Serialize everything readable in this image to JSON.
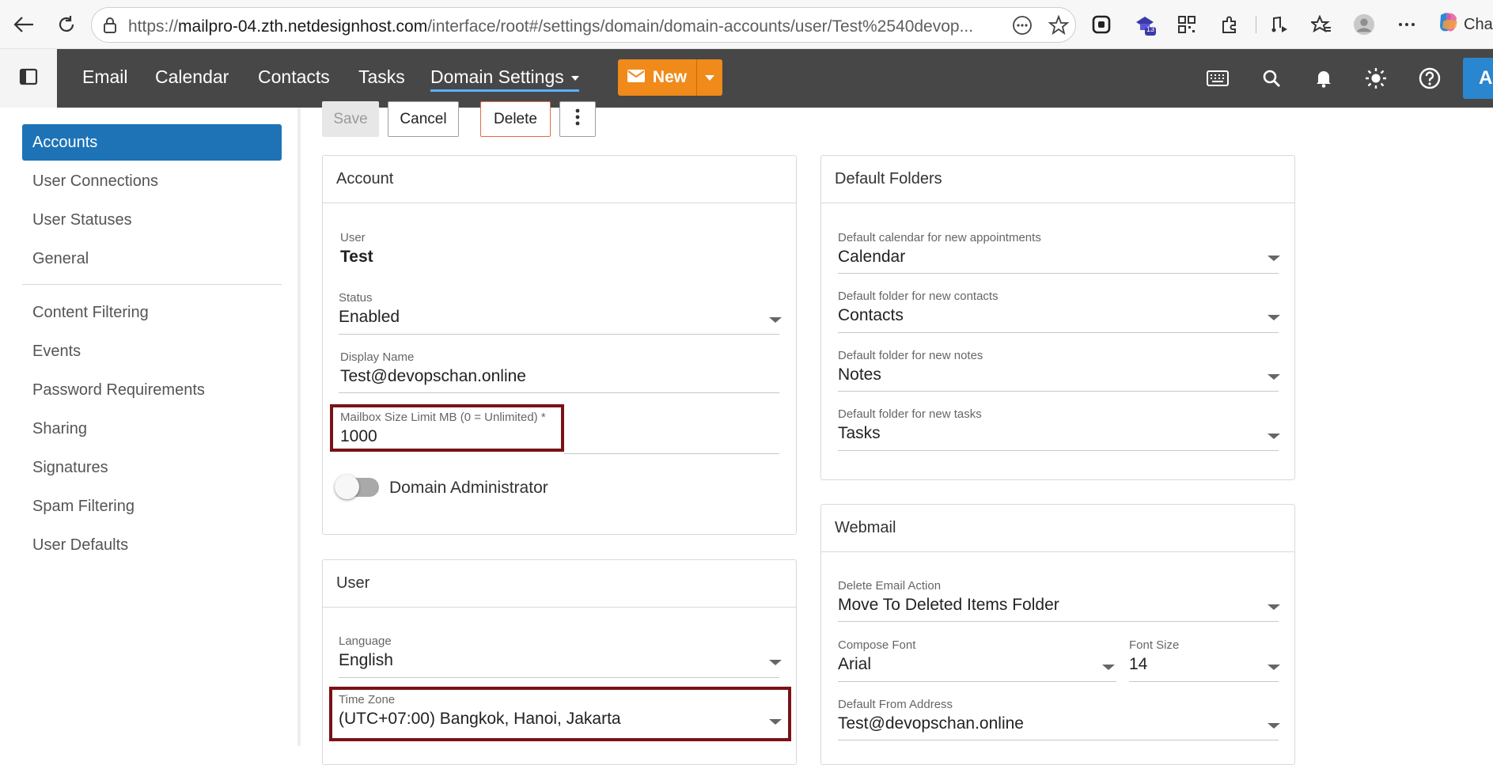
{
  "browser": {
    "url_prefix": "https://",
    "url_host": "mailpro-04.zth.netdesignhost.com",
    "url_path": "/interface/root#/settings/domain/domain-accounts/user/Test%2540devop...",
    "badge_count": "13",
    "copilot_label": "Cha"
  },
  "nav": {
    "items": [
      "Email",
      "Calendar",
      "Contacts",
      "Tasks"
    ],
    "active": "Domain Settings",
    "new_label": "New",
    "avatar_letter": "A"
  },
  "sidebar": {
    "group1": [
      "Accounts",
      "User Connections",
      "User Statuses",
      "General"
    ],
    "group2": [
      "Content Filtering",
      "Events",
      "Password Requirements",
      "Sharing",
      "Signatures",
      "Spam Filtering",
      "User Defaults"
    ]
  },
  "toolbar": {
    "save": "Save",
    "cancel": "Cancel",
    "delete": "Delete"
  },
  "account": {
    "title": "Account",
    "user_label": "User",
    "user_value": "Test",
    "status_label": "Status",
    "status_value": "Enabled",
    "display_label": "Display Name",
    "display_value": "Test@devopschan.online",
    "mailbox_label": "Mailbox Size Limit MB (0 = Unlimited) *",
    "mailbox_value": "1000",
    "domain_admin_label": "Domain Administrator",
    "domain_admin_on": false
  },
  "user_card": {
    "title": "User",
    "language_label": "Language",
    "language_value": "English",
    "tz_label": "Time Zone",
    "tz_value": "(UTC+07:00) Bangkok, Hanoi, Jakarta"
  },
  "default_folders": {
    "title": "Default Folders",
    "cal_label": "Default calendar for new appointments",
    "cal_value": "Calendar",
    "contacts_label": "Default folder for new contacts",
    "contacts_value": "Contacts",
    "notes_label": "Default folder for new notes",
    "notes_value": "Notes",
    "tasks_label": "Default folder for new tasks",
    "tasks_value": "Tasks"
  },
  "webmail": {
    "title": "Webmail",
    "delete_label": "Delete Email Action",
    "delete_value": "Move To Deleted Items Folder",
    "font_label": "Compose Font",
    "font_value": "Arial",
    "size_label": "Font Size",
    "size_value": "14",
    "from_label": "Default From Address",
    "from_value": "Test@devopschan.online"
  },
  "colors": {
    "accent": "#1e73b7",
    "new_button": "#f08a1a",
    "highlight": "#7a1218",
    "nav_bg": "#474747"
  }
}
